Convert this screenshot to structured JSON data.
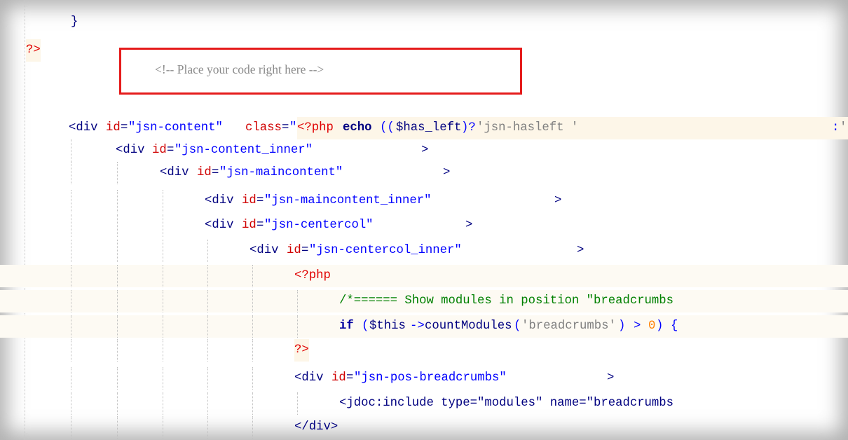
{
  "editor": {
    "language": "php-html",
    "code_lines": [
      "}",
      "?>",
      "<div id=\"jsn-content\" class=\"<?php echo (($has_left)?'jsn-hasleft ':'",
      "<div id=\"jsn-content_inner\">",
      "<div id=\"jsn-maincontent\">",
      "<div id=\"jsn-maincontent_inner\">",
      "<div id=\"jsn-centercol\">",
      "<div id=\"jsn-centercol_inner\">",
      "<?php",
      "/*====== Show modules in position \"breadcrumbs",
      "if ($this->countModules('breadcrumbs') > 0) {",
      "?>",
      "<div id=\"jsn-pos-breadcrumbs\">",
      "<jdoc:include type=\"modules\" name=\"breadcrumbs",
      "</div>"
    ],
    "tokens": {
      "l0": {
        "brace": "}"
      },
      "l1": {
        "php_close": "?>"
      },
      "l2": {
        "open": "<div",
        "id_attr": "id",
        "eq1": "=",
        "id_val": "\"jsn-content\"",
        "class_attr": "class",
        "eq2": "=",
        "q_open": "\"",
        "php_open": "<?php",
        "echo": "echo",
        "paren": "((",
        "var": "$has_left",
        "ternary": ")?",
        "s1": "'jsn-hasleft '",
        "colon": ":",
        "s2": "'"
      },
      "l3": {
        "open": "<div",
        "attr": "id",
        "eq": "=",
        "val": "\"jsn-content_inner\"",
        "close": ">"
      },
      "l4": {
        "open": "<div",
        "attr": "id",
        "eq": "=",
        "val": "\"jsn-maincontent\"",
        "close": ">"
      },
      "l5": {
        "open": "<div",
        "attr": "id",
        "eq": "=",
        "val": "\"jsn-maincontent_inner\"",
        "close": ">"
      },
      "l6": {
        "open": "<div",
        "attr": "id",
        "eq": "=",
        "val": "\"jsn-centercol\"",
        "close": ">"
      },
      "l7": {
        "open": "<div",
        "attr": "id",
        "eq": "=",
        "val": "\"jsn-centercol_inner\"",
        "close": ">"
      },
      "l8": {
        "php_open": "<?php"
      },
      "l9": {
        "comment": "/*====== Show modules in position \"breadcrumbs"
      },
      "l10": {
        "if": "if",
        "p1": "(",
        "this": "$this",
        "arrow": "->",
        "method": "countModules",
        "p2": "(",
        "arg": "'breadcrumbs'",
        "p3": ")",
        "gt": ">",
        "zero": "0",
        "p4": ")",
        "brace": "{"
      },
      "l11": {
        "php_close": "?>"
      },
      "l12": {
        "open": "<div",
        "attr": "id",
        "eq": "=",
        "val": "\"jsn-pos-breadcrumbs\"",
        "close": ">"
      },
      "l13": {
        "text": "<jdoc:include type=\"modules\" name=\"breadcrumbs"
      },
      "l14": {
        "close_tag": "</div>"
      }
    }
  },
  "callout": {
    "text": "<!-- Place your code right here -->",
    "border_color": "#e51b1b"
  },
  "colors": {
    "tag": "#000080",
    "attribute": "#d00000",
    "string": "#0000ff",
    "php_delimiter": "#e00000",
    "comment": "#008000",
    "number": "#ff8000",
    "single_quote_string": "#808080"
  }
}
